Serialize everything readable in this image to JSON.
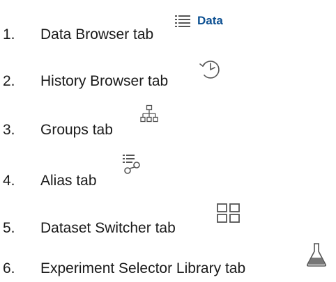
{
  "items": [
    {
      "number": "1.",
      "label": "Data Browser tab",
      "icon": "list-icon",
      "icon_text": "Data"
    },
    {
      "number": "2.",
      "label": "History Browser tab",
      "icon": "history-clock-icon"
    },
    {
      "number": "3.",
      "label": "Groups tab",
      "icon": "hierarchy-icon"
    },
    {
      "number": "4.",
      "label": "Alias tab",
      "icon": "alias-link-icon"
    },
    {
      "number": "5.",
      "label": "Dataset Switcher tab",
      "icon": "grid-icon"
    },
    {
      "number": "6.",
      "label": "Experiment Selector Library tab",
      "icon": "flask-icon"
    }
  ],
  "colors": {
    "text": "#1a1a1a",
    "accent": "#0b4f91",
    "icon": "#555555"
  }
}
